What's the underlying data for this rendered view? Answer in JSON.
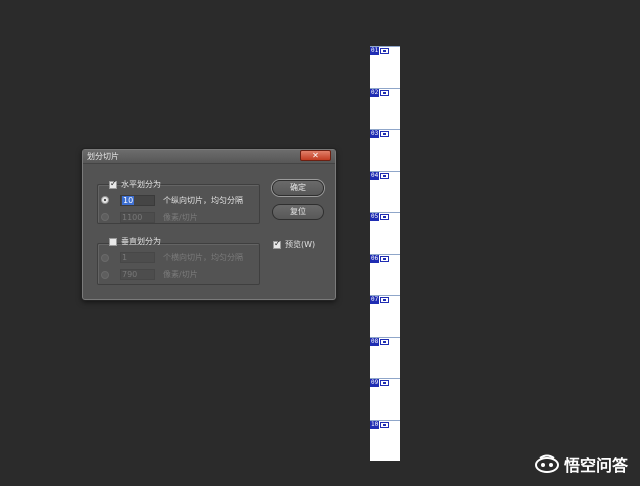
{
  "slices": [
    "01",
    "02",
    "03",
    "04",
    "05",
    "06",
    "07",
    "08",
    "09",
    "10"
  ],
  "dialog": {
    "title": "划分切片",
    "close_label": "✕",
    "horizontal": {
      "checkbox_label": "水平划分为",
      "count_value": "10",
      "count_label": "个纵向切片，均匀分隔",
      "pixels_value": "1100",
      "pixels_label": "像素/切片"
    },
    "vertical": {
      "checkbox_label": "垂直划分为",
      "count_value": "1",
      "count_label": "个横向切片，均匀分隔",
      "pixels_value": "790",
      "pixels_label": "像素/切片"
    },
    "ok_label": "确定",
    "reset_label": "复位",
    "preview_label": "预览(W)"
  },
  "watermark": {
    "text": "悟空问答"
  }
}
